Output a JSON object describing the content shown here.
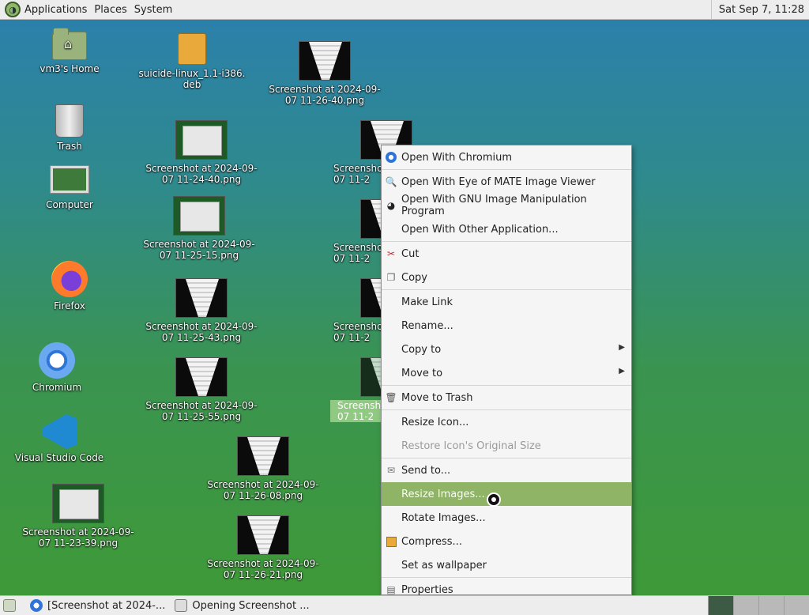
{
  "top_panel": {
    "menus": [
      "Applications",
      "Places",
      "System"
    ],
    "clock": "Sat Sep  7, 11:28"
  },
  "desktop_icons": [
    {
      "label": "vm3's Home",
      "icon": "home-folder-icon"
    },
    {
      "label": "Trash",
      "icon": "trash-icon"
    },
    {
      "label": "Computer",
      "icon": "computer-icon"
    },
    {
      "label": "Firefox",
      "icon": "firefox-icon"
    },
    {
      "label": "Chromium",
      "icon": "chromium-icon"
    },
    {
      "label": "Visual Studio Code",
      "icon": "vscode-icon"
    },
    {
      "label": "Screenshot at 2024-09-\n07 11-23-39.png",
      "icon": "image-thumbnail-icon"
    },
    {
      "label": "suicide-linux_1.1-i386.\ndeb",
      "icon": "package-icon"
    },
    {
      "label": "Screenshot at 2024-09-\n07 11-24-40.png",
      "icon": "image-thumbnail-icon"
    },
    {
      "label": "Screenshot at 2024-09-\n07 11-25-15.png",
      "icon": "image-thumbnail-icon"
    },
    {
      "label": "Screenshot at 2024-09-\n07 11-25-43.png",
      "icon": "image-thumbnail-icon"
    },
    {
      "label": "Screenshot at 2024-09-\n07 11-25-55.png",
      "icon": "image-thumbnail-icon"
    },
    {
      "label": "Screenshot at 2024-09-\n07 11-26-08.png",
      "icon": "image-thumbnail-icon"
    },
    {
      "label": "Screenshot at 2024-09-\n07 11-26-21.png",
      "icon": "image-thumbnail-icon"
    },
    {
      "label": "Screenshot at 2024-09-\n07 11-26-40.png",
      "icon": "image-thumbnail-icon"
    },
    {
      "label": "Screensho\n07 11-2",
      "icon": "image-thumbnail-icon"
    },
    {
      "label": "Screensho\n07 11-2",
      "icon": "image-thumbnail-icon"
    },
    {
      "label": "Screensho\n07 11-2",
      "icon": "image-thumbnail-icon"
    },
    {
      "label": "Screensho\n07 11-2",
      "icon": "image-thumbnail-icon"
    }
  ],
  "context_menu": {
    "items": [
      {
        "label": "Open With Chromium",
        "icon": "chromium-icon"
      },
      {
        "label": "Open With Eye of MATE Image Viewer",
        "icon": "image-viewer-icon"
      },
      {
        "label": "Open With GNU Image Manipulation Program",
        "icon": "gimp-icon"
      },
      {
        "label": "Open With Other Application...",
        "icon": ""
      },
      {
        "label": "Cut",
        "icon": "scissors-icon"
      },
      {
        "label": "Copy",
        "icon": "copy-icon"
      },
      {
        "label": "Make Link",
        "icon": ""
      },
      {
        "label": "Rename...",
        "icon": ""
      },
      {
        "label": "Copy to",
        "icon": "",
        "submenu": true
      },
      {
        "label": "Move to",
        "icon": "",
        "submenu": true
      },
      {
        "label": "Move to Trash",
        "icon": "trash-icon"
      },
      {
        "label": "Resize Icon...",
        "icon": ""
      },
      {
        "label": "Restore Icon's Original Size",
        "icon": "",
        "disabled": true
      },
      {
        "label": "Send to...",
        "icon": "send-icon"
      },
      {
        "label": "Resize Images...",
        "icon": "",
        "highlighted": true
      },
      {
        "label": "Rotate Images...",
        "icon": ""
      },
      {
        "label": "Compress...",
        "icon": "archive-icon"
      },
      {
        "label": "Set as wallpaper",
        "icon": ""
      },
      {
        "label": "Properties",
        "icon": "properties-icon"
      }
    ]
  },
  "bottom_panel": {
    "tasks": [
      {
        "label": "[Screenshot at 2024-...",
        "icon": "chromium-icon"
      },
      {
        "label": "Opening Screenshot ...",
        "icon": "window-icon"
      }
    ]
  },
  "colors": {
    "menu_highlight": "#8fb466",
    "panel_bg": "#ededed",
    "desktop_top": "#2a7fae",
    "desktop_bottom": "#3f9a36"
  }
}
